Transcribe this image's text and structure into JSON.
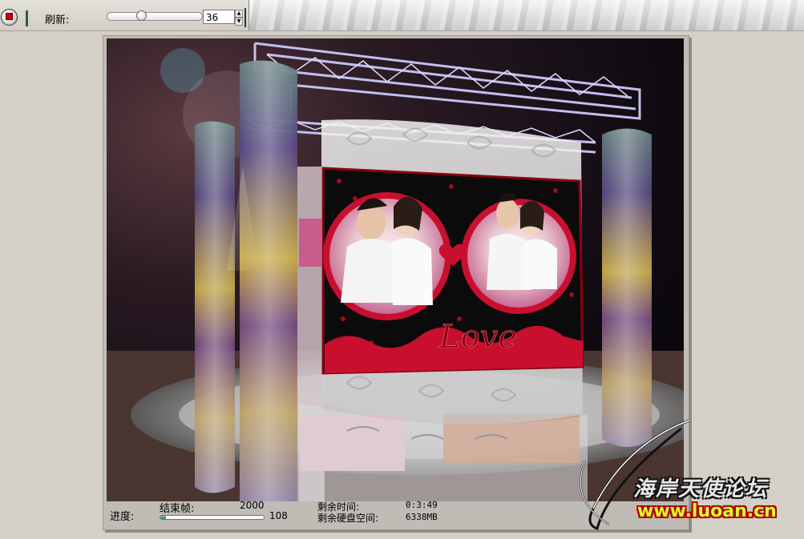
{
  "toolbar": {
    "refresh_label": "刷新:",
    "refresh_value": "36",
    "refresh_slider_level": 0.35
  },
  "status": {
    "progress_label": "进度:",
    "end_frame_label": "结束帧:",
    "end_frame_value": "2000",
    "current_frame": "108",
    "progress_fraction": 0.054,
    "time_left_label": "剩余时间:",
    "time_left_value": "0:3:49",
    "disk_label": "剩余硬盘空间:",
    "disk_value": "6338MB"
  },
  "render": {
    "banner_text": "Love"
  },
  "watermark": {
    "title": "海岸天使论坛",
    "url": "www.luoan.cn"
  },
  "colors": {
    "toolbar_bg": "#d4d0c8",
    "render_bg": "#0e0a10",
    "banner_red": "#c8102e",
    "truss": "#b8b4e8",
    "watermark_url": "#d9ff2a"
  },
  "icons": [
    "record-icon",
    "toolbar-grip-icon",
    "spin-up-icon",
    "spin-down-icon"
  ]
}
